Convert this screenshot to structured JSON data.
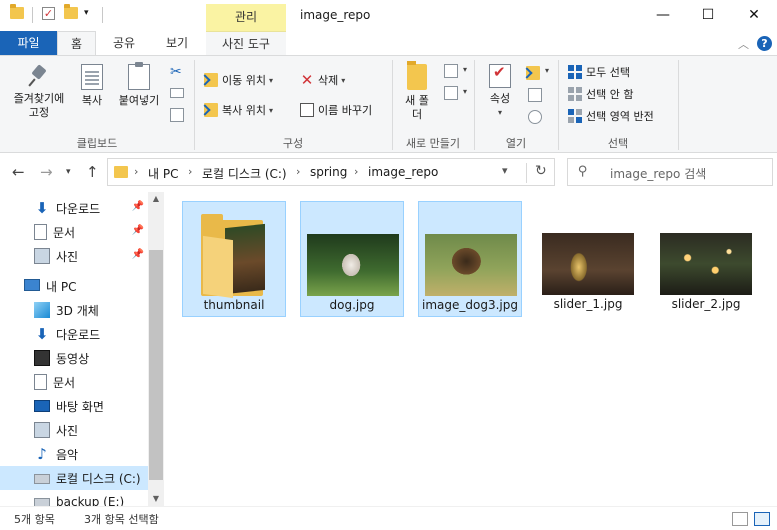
{
  "window": {
    "title": "image_repo",
    "context_tab_group": "관리",
    "minimize": "—",
    "maximize": "☐",
    "close": "✕"
  },
  "ribbon_tabs": {
    "file": "파일",
    "home": "홈",
    "share": "공유",
    "view": "보기",
    "picture_tools": "사진 도구"
  },
  "ribbon": {
    "clipboard": {
      "pin": "즐겨찾기에 고정",
      "copy": "복사",
      "paste": "붙여넣기",
      "label": "클립보드"
    },
    "organize": {
      "move_to": "이동 위치",
      "copy_to": "복사 위치",
      "delete": "삭제",
      "rename": "이름 바꾸기",
      "label": "구성"
    },
    "new": {
      "new_folder": "새 폴더",
      "label": "새로 만들기"
    },
    "open": {
      "properties": "속성",
      "label": "열기"
    },
    "select": {
      "select_all": "모두 선택",
      "select_none": "선택 안 함",
      "invert": "선택 영역 반전",
      "label": "선택"
    }
  },
  "address": {
    "segments": [
      "내 PC",
      "로컬 디스크 (C:)",
      "spring",
      "image_repo"
    ],
    "search_placeholder": "image_repo 검색"
  },
  "navpane": {
    "quick": [
      {
        "label": "다운로드",
        "icon": "download-icon"
      },
      {
        "label": "문서",
        "icon": "documents-icon"
      },
      {
        "label": "사진",
        "icon": "pictures-icon"
      }
    ],
    "this_pc": "내 PC",
    "pc_items": [
      {
        "label": "3D 개체",
        "icon": "3d-objects-icon"
      },
      {
        "label": "다운로드",
        "icon": "download-icon"
      },
      {
        "label": "동영상",
        "icon": "video-icon"
      },
      {
        "label": "문서",
        "icon": "documents-icon"
      },
      {
        "label": "바탕 화면",
        "icon": "desktop-icon"
      },
      {
        "label": "사진",
        "icon": "pictures-icon"
      },
      {
        "label": "음악",
        "icon": "music-icon"
      },
      {
        "label": "로컬 디스크 (C:)",
        "icon": "drive-icon"
      },
      {
        "label": "backup (E:)",
        "icon": "drive-icon"
      }
    ]
  },
  "files": [
    {
      "name": "thumbnail",
      "type": "folder",
      "selected": true
    },
    {
      "name": "dog.jpg",
      "type": "image",
      "selected": true
    },
    {
      "name": "image_dog3.jpg",
      "type": "image",
      "selected": true
    },
    {
      "name": "slider_1.jpg",
      "type": "image",
      "selected": false
    },
    {
      "name": "slider_2.jpg",
      "type": "image",
      "selected": false
    }
  ],
  "status": {
    "count": "5개 항목",
    "selected": "3개 항목 선택함"
  }
}
